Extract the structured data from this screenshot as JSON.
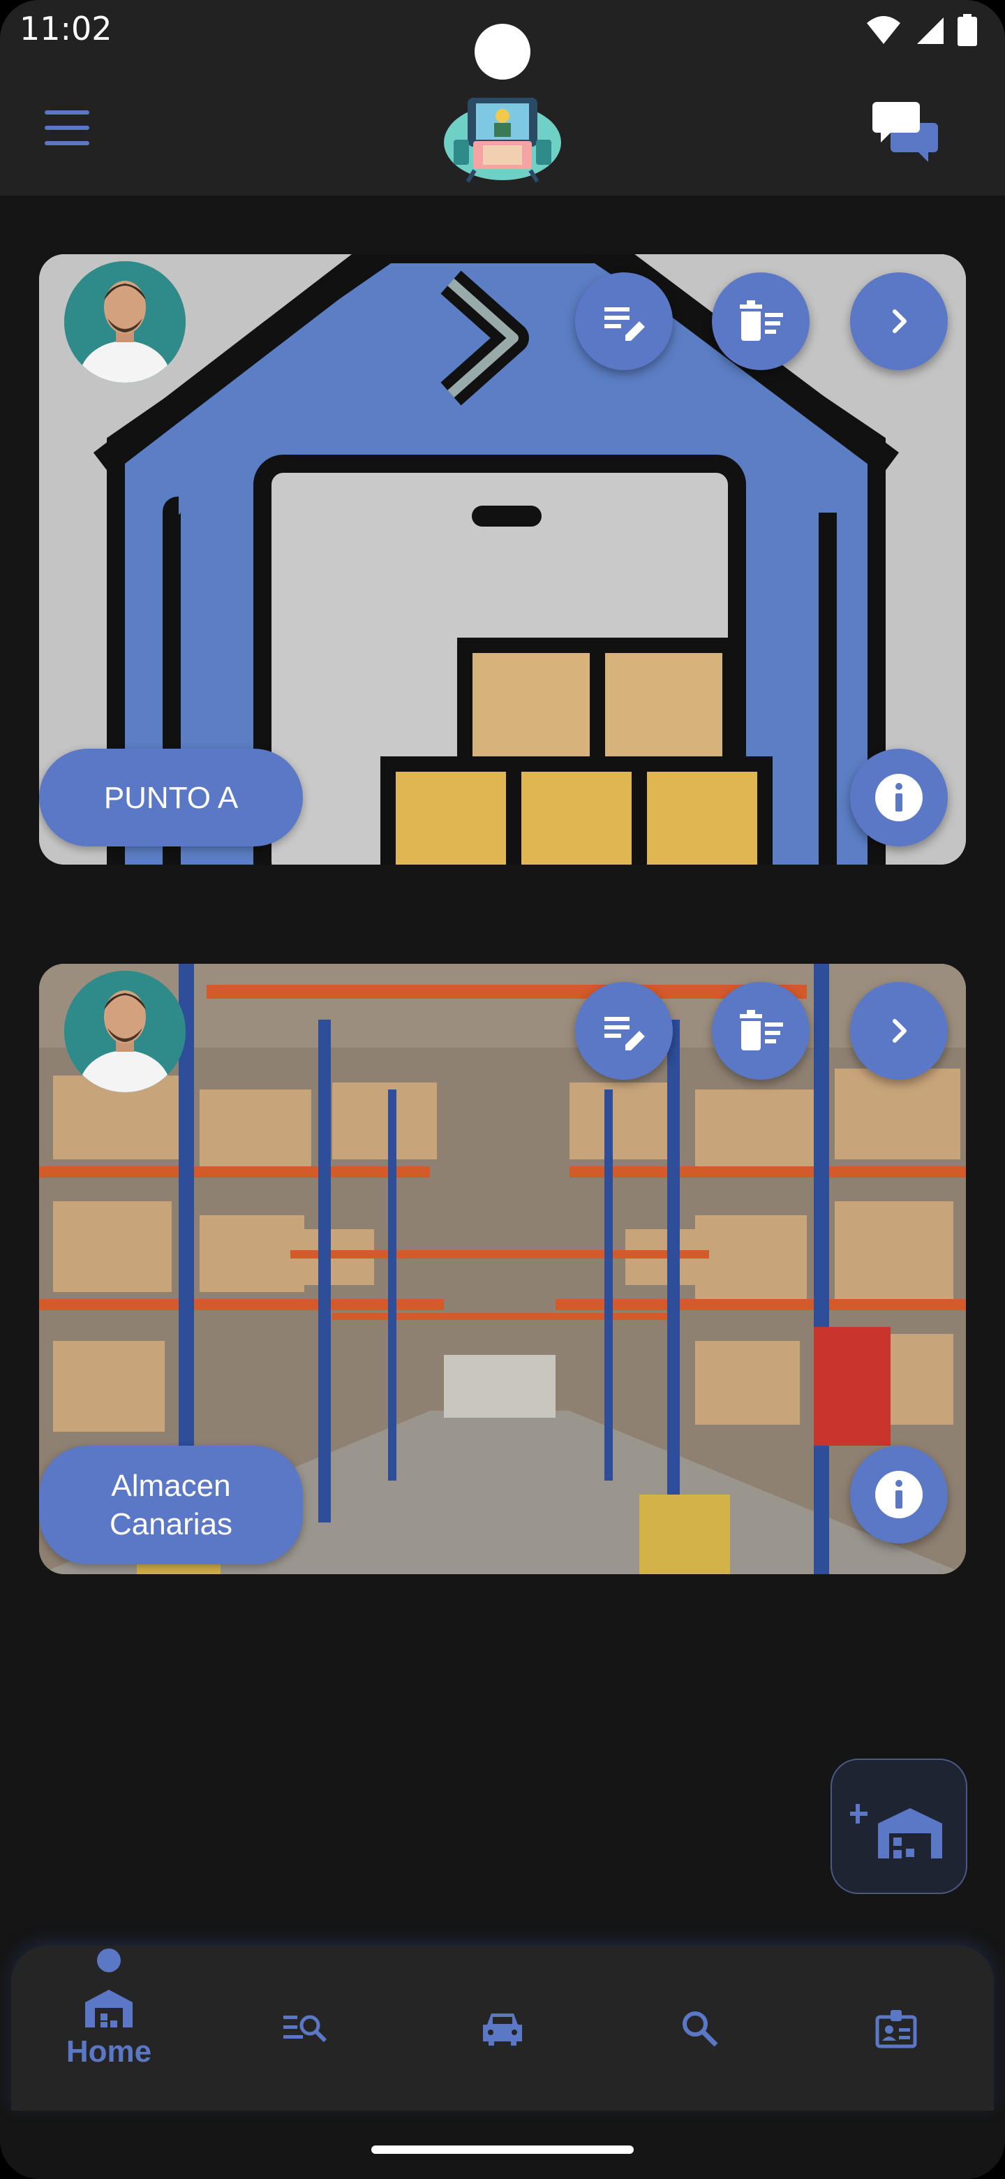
{
  "status_bar": {
    "time": "11:02"
  },
  "app_bar": {
    "menu_icon": "hamburger-menu-icon",
    "logo_icon": "app-logo-icon",
    "chat_icon": "chat-bubbles-icon"
  },
  "warehouses": [
    {
      "name": "PUNTO A",
      "image": "warehouse-illustration"
    },
    {
      "name": "Almacen\nCanarias",
      "image": "warehouse-photo"
    }
  ],
  "card_actions": {
    "edit_icon": "edit-note-icon",
    "delete_icon": "delete-sweep-icon",
    "next_icon": "chevron-right-icon",
    "info_icon": "info-icon"
  },
  "fab": {
    "icon": "add-warehouse-icon"
  },
  "bottom_nav": {
    "items": [
      {
        "label": "Home",
        "icon": "warehouse-home-icon",
        "active": true
      },
      {
        "label": "",
        "icon": "manage-search-icon",
        "active": false
      },
      {
        "label": "",
        "icon": "car-icon",
        "active": false
      },
      {
        "label": "",
        "icon": "search-icon",
        "active": false
      },
      {
        "label": "",
        "icon": "badge-icon",
        "active": false
      }
    ]
  },
  "colors": {
    "accent": "#5b78c6",
    "background": "#151515",
    "bar": "#222222"
  }
}
